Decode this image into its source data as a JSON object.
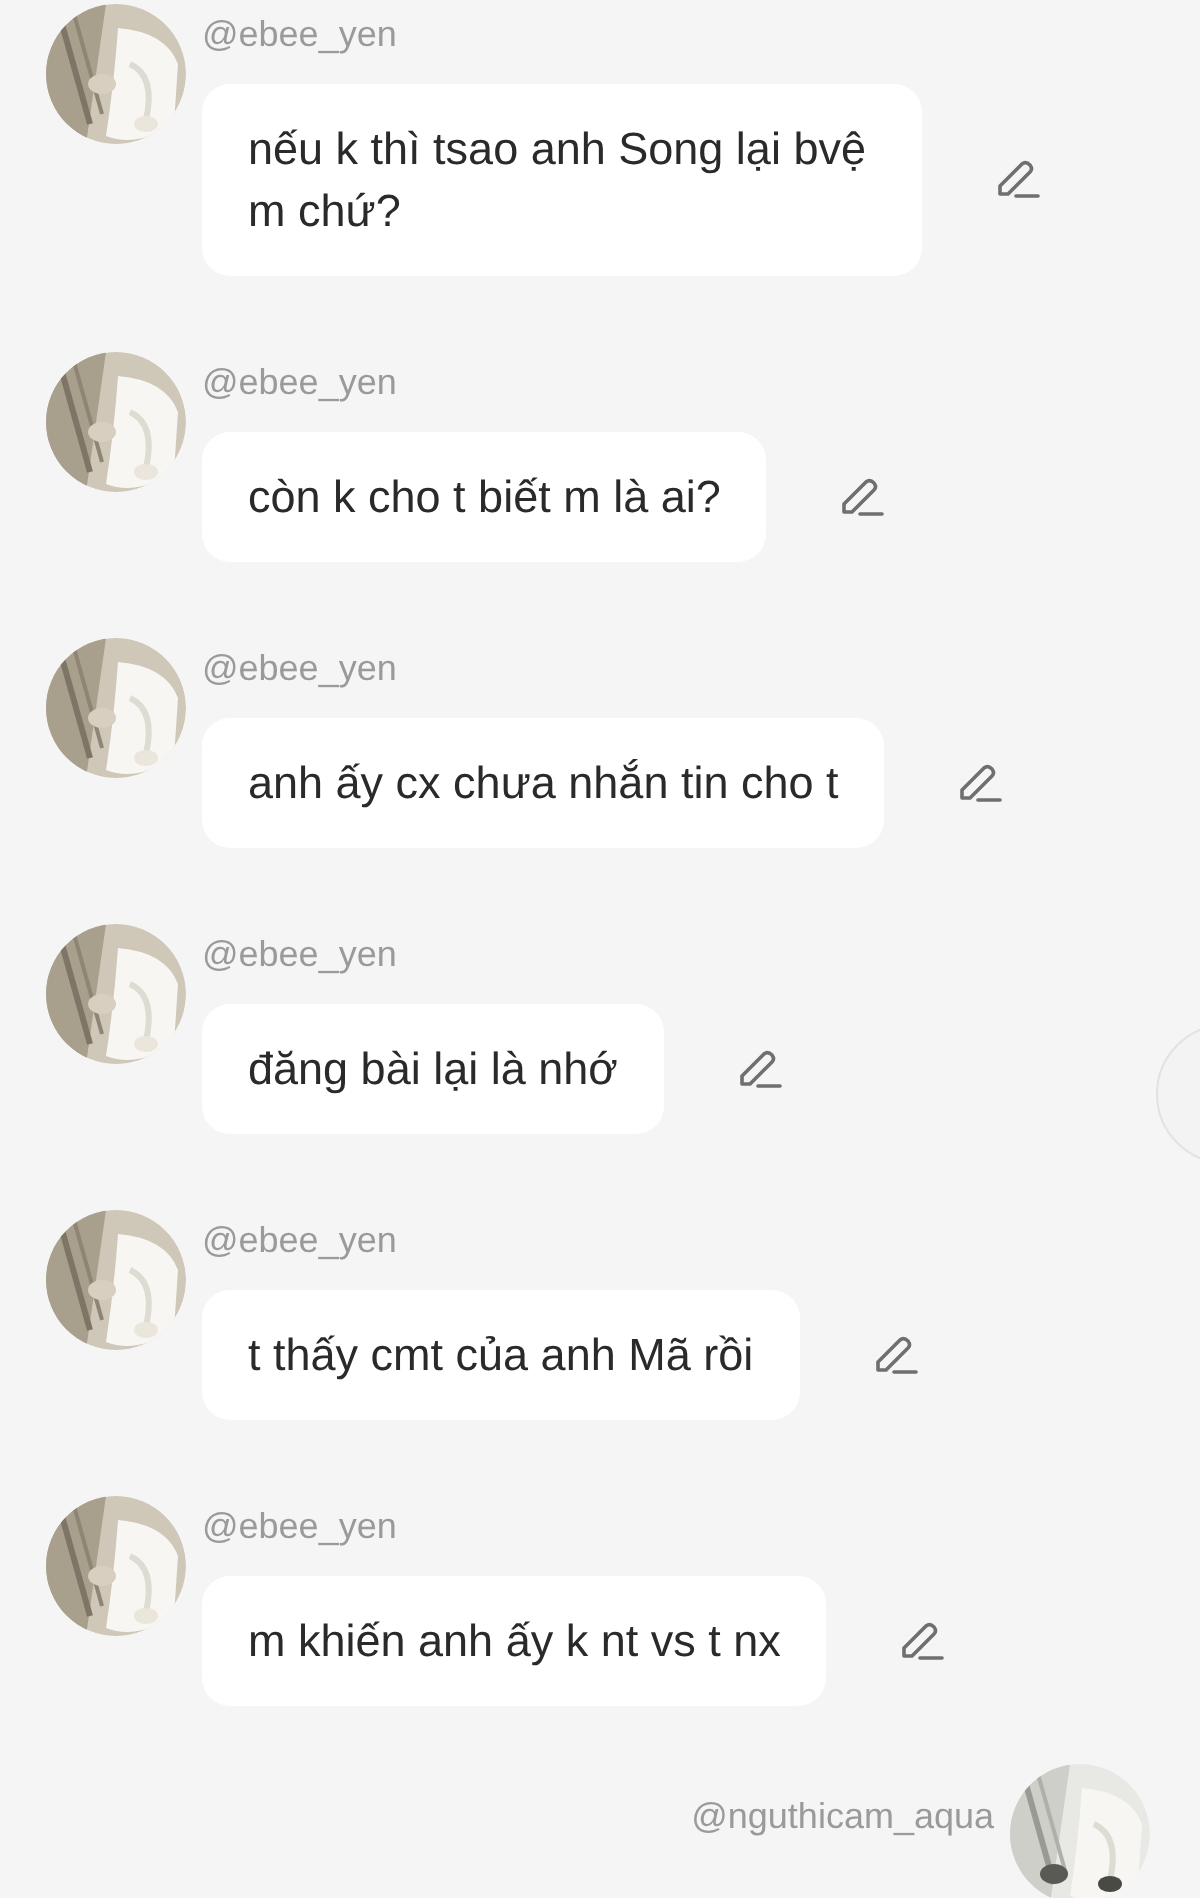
{
  "messages": [
    {
      "user": "@ebee_yen",
      "text": "nếu k thì tsao anh Song lại bvệ m chứ?"
    },
    {
      "user": "@ebee_yen",
      "text": "còn k cho t biết m là ai?"
    },
    {
      "user": "@ebee_yen",
      "text": "anh ấy cx chưa nhắn tin cho t"
    },
    {
      "user": "@ebee_yen",
      "text": "đăng bài lại là nhớ"
    },
    {
      "user": "@ebee_yen",
      "text": "t thấy cmt của anh Mã rồi"
    },
    {
      "user": "@ebee_yen",
      "text": "m khiến anh ấy k nt vs t nx"
    }
  ],
  "reply": {
    "user": "@nguthicam_aqua"
  }
}
